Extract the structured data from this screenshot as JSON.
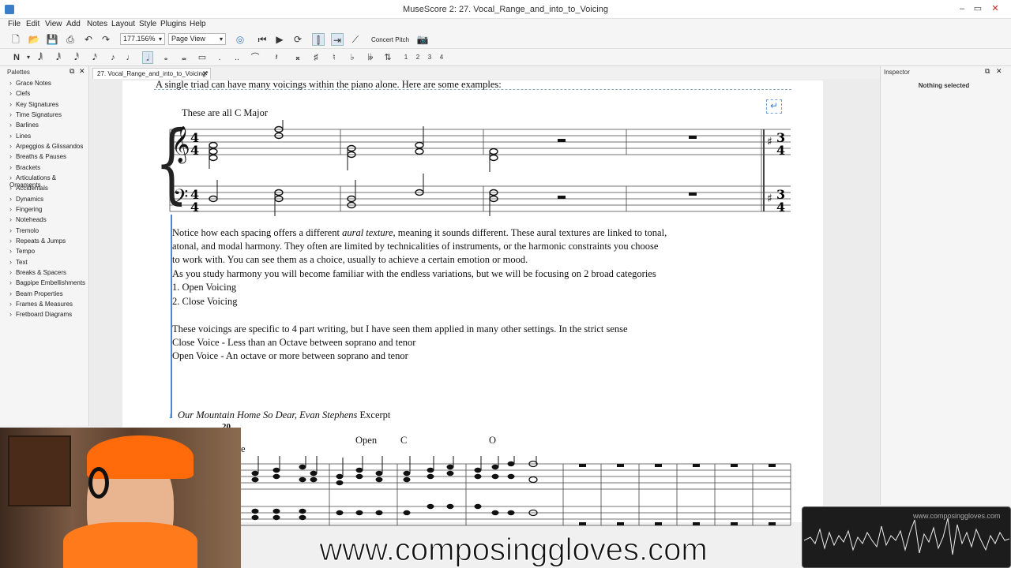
{
  "window": {
    "title": "MuseScore 2: 27. Vocal_Range_and_into_to_Voicing"
  },
  "menu": [
    "File",
    "Edit",
    "View",
    "Add",
    "Notes",
    "Layout",
    "Style",
    "Plugins",
    "Help"
  ],
  "toolbar": {
    "zoom": "177.156%",
    "view_mode": "Page View",
    "concert_pitch": "Concert Pitch"
  },
  "voices": [
    "1",
    "2",
    "3",
    "4"
  ],
  "palettes": {
    "header": "Palettes",
    "items": [
      "Grace Notes",
      "Clefs",
      "Key Signatures",
      "Time Signatures",
      "Barlines",
      "Lines",
      "Arpeggios & Glissandos",
      "Breaths & Pauses",
      "Brackets",
      "Articulations & Ornaments",
      "Accidentals",
      "Dynamics",
      "Fingering",
      "Noteheads",
      "Tremolo",
      "Repeats & Jumps",
      "Tempo",
      "Text",
      "Breaks & Spacers",
      "Bagpipe Embellishments",
      "Beam Properties",
      "Frames & Measures",
      "Fretboard Diagrams"
    ]
  },
  "tab": {
    "label": "27. Vocal_Range_and_into_to_Voicing*"
  },
  "inspector": {
    "header": "Inspector",
    "status": "Nothing selected"
  },
  "score": {
    "intro": "A single triad can have many voicings within the piano alone. Here are some examples:",
    "staff_label": "These are all C Major",
    "paragraph": [
      "Notice how each spacing offers a different ",
      "aural texture",
      ", meaning it sounds different. These aural textures are linked to tonal,",
      "atonal, and modal harmony. They often are limited by technicalities of instruments, or the harmonic constraints you choose",
      "to work with. You can see them as a choice, usually to achieve a certain emotion or mood.",
      "As you study harmony you will become familiar with the endless variations, but we will be focusing on 2 broad categories",
      "1. Open Voicing",
      "2. Close Voicing",
      "These voicings are specific to 4 part writing, but I have seen them applied in many other settings. In the strict sense",
      "Close Voice - Less than an Octave between soprano and tenor",
      "Open Voice - An octave or more between soprano and tenor"
    ],
    "excerpt_title": "Our Mountain Home So Dear, Evan Stephens",
    "excerpt_suffix": " Excerpt",
    "measure_number": "20",
    "chord_labels": [
      "Open",
      "C",
      "O"
    ],
    "partial_label": "e"
  },
  "watermark": "www.composinggloves.com",
  "audio_overlay": "www.composinggloves.com"
}
